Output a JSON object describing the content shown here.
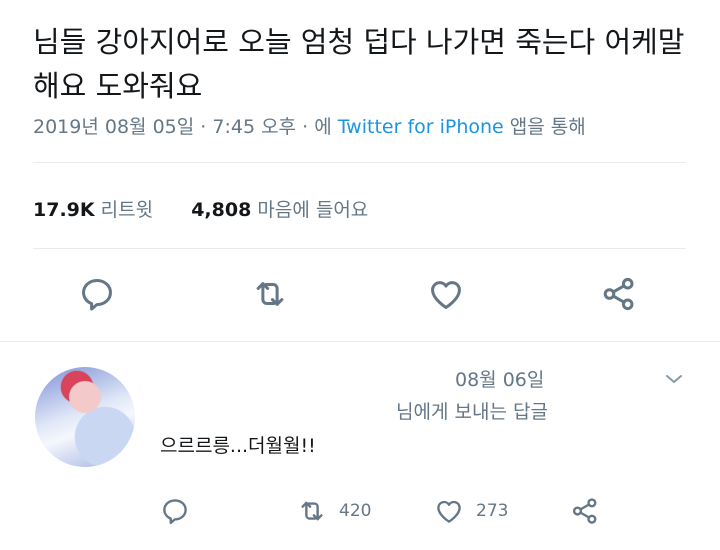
{
  "tweet": {
    "text": "님들 강아지어로 오늘 엄청 덥다 나가면 죽는다 어케말해요 도와줘요",
    "date": "2019년 08월 05일",
    "time": "7:45 오후",
    "via_prefix": "에",
    "client": "Twitter for iPhone",
    "via_suffix": "앱을 통해",
    "separator": "·"
  },
  "stats": {
    "retweets_count": "17.9K",
    "retweets_label": "리트윗",
    "likes_count": "4,808",
    "likes_label": "마음에 들어요"
  },
  "actions": {
    "reply_icon": "reply-icon",
    "retweet_icon": "retweet-icon",
    "like_icon": "heart-icon",
    "share_icon": "share-icon"
  },
  "reply": {
    "date": "08월 06일",
    "replying_to": "님에게 보내는 답글",
    "text": "으르르릉...더월월!!",
    "retweet_count": "420",
    "like_count": "273"
  },
  "colors": {
    "text": "#14171a",
    "secondary": "#657786",
    "link": "#1b95e0",
    "divider": "#e6ecf0"
  }
}
